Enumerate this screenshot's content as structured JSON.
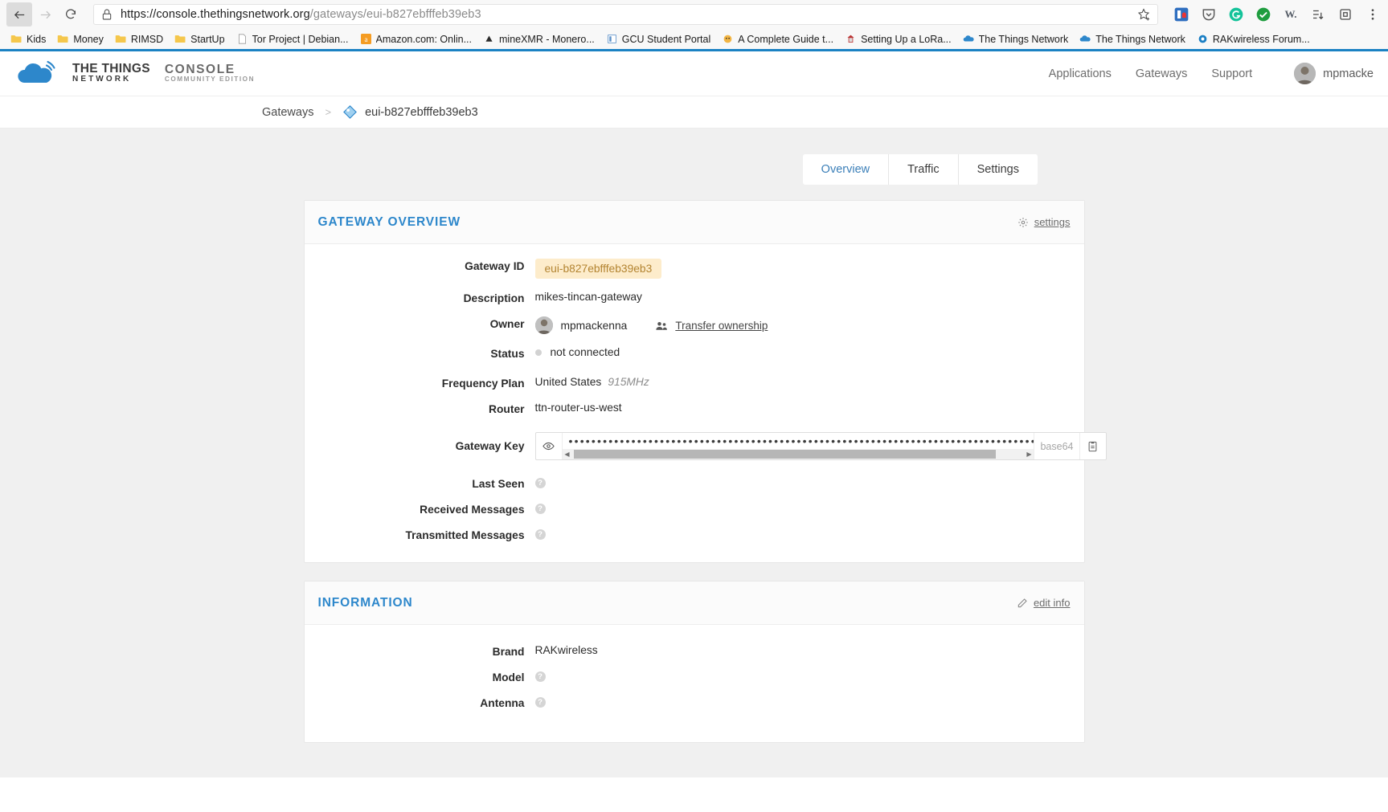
{
  "browser": {
    "back_icon": "arrow-left-icon",
    "forward_icon": "arrow-right-icon",
    "reload_icon": "reload-icon",
    "lock_icon": "lock-icon",
    "url_host": "https://console.thethingsnetwork.org",
    "url_path": "/gateways/eui-b827ebfffeb39eb3",
    "url_full": "https://console.thethingsnetwork.org/gateways/eui-b827ebfffeb39eb3",
    "star_icon": "favorite-star-icon",
    "extensions": [
      {
        "name": "lastpass-extension-icon",
        "color": "#2f6fc0"
      },
      {
        "name": "pocket-extension-icon",
        "color": "#5a5a5a"
      },
      {
        "name": "grammarly-extension-icon",
        "color": "#14c39a"
      },
      {
        "name": "checkmark-extension-icon",
        "color": "#1f9d3f"
      },
      {
        "name": "wikipedia-extension-icon",
        "color": "#555c66"
      },
      {
        "name": "collections-icon",
        "color": "#4a4a4a"
      },
      {
        "name": "browser-extensions-icon",
        "color": "#4a4a4a"
      },
      {
        "name": "browser-settings-icon",
        "color": "#4a4a4a"
      }
    ],
    "bookmarks": [
      {
        "label": "Kids",
        "icon": "folder-icon",
        "type": "folder"
      },
      {
        "label": "Money",
        "icon": "folder-icon",
        "type": "folder"
      },
      {
        "label": "RIMSD",
        "icon": "folder-icon",
        "type": "folder"
      },
      {
        "label": "StartUp",
        "icon": "folder-icon",
        "type": "folder"
      },
      {
        "label": "Tor Project | Debian...",
        "icon": "page-icon",
        "type": "link"
      },
      {
        "label": "Amazon.com: Onlin...",
        "icon": "amazon-favicon",
        "type": "link"
      },
      {
        "label": "mineXMR - Monero...",
        "icon": "minexmr-favicon",
        "type": "link"
      },
      {
        "label": "GCU Student Portal",
        "icon": "gcu-favicon",
        "type": "link"
      },
      {
        "label": "A Complete Guide t...",
        "icon": "fox-favicon",
        "type": "link"
      },
      {
        "label": "Setting Up a LoRa...",
        "icon": "cp-favicon",
        "type": "link"
      },
      {
        "label": "The Things Network",
        "icon": "ttn-cloud-favicon",
        "type": "link"
      },
      {
        "label": "The Things Network",
        "icon": "ttn-cloud-favicon",
        "type": "link"
      },
      {
        "label": "RAKwireless Forum...",
        "icon": "rak-favicon",
        "type": "link"
      }
    ]
  },
  "header": {
    "logo_icon": "ttn-cloud-logo",
    "brand_line1": "THE THINGS",
    "brand_line2": "NETWORK",
    "product_line1": "CONSOLE",
    "product_line2": "COMMUNITY EDITION",
    "nav": [
      {
        "label": "Applications",
        "name": "nav-applications"
      },
      {
        "label": "Gateways",
        "name": "nav-gateways"
      },
      {
        "label": "Support",
        "name": "nav-support"
      }
    ],
    "username": "mpmacke",
    "avatar_icon": "user-avatar"
  },
  "breadcrumb": {
    "root": "Gateways",
    "separator": ">",
    "gateway_icon": "gateway-tag-icon",
    "current": "eui-b827ebfffeb39eb3"
  },
  "tabs": [
    {
      "label": "Overview",
      "active": true
    },
    {
      "label": "Traffic",
      "active": false
    },
    {
      "label": "Settings",
      "active": false
    }
  ],
  "gateway_overview": {
    "title": "GATEWAY OVERVIEW",
    "action_label": "settings",
    "action_icon": "gear-icon",
    "fields": {
      "gateway_id_label": "Gateway ID",
      "gateway_id_value": "eui-b827ebfffeb39eb3",
      "description_label": "Description",
      "description_value": "mikes-tincan-gateway",
      "owner_label": "Owner",
      "owner_value": "mpmackenna",
      "transfer_label": "Transfer ownership",
      "transfer_icon": "people-icon",
      "status_label": "Status",
      "status_value": "not connected",
      "frequency_plan_label": "Frequency Plan",
      "frequency_plan_value": "United States",
      "frequency_plan_freq": "915MHz",
      "router_label": "Router",
      "router_value": "ttn-router-us-west",
      "gateway_key_label": "Gateway Key",
      "gateway_key_value": "••••••••••••••••••••••••••••••••••••••••••••••••••••••••••••••••••••••••••••••••••••••••••••••••••••••••••••••••••••••••••••••••",
      "gateway_key_format": "base64",
      "eye_icon": "eye-icon",
      "copy_icon": "clipboard-copy-icon",
      "last_seen_label": "Last Seen",
      "last_seen_value": "?",
      "received_messages_label": "Received Messages",
      "received_messages_value": "?",
      "transmitted_messages_label": "Transmitted Messages",
      "transmitted_messages_value": "?"
    }
  },
  "information": {
    "title": "INFORMATION",
    "action_label": "edit info",
    "action_icon": "pencil-icon",
    "fields": {
      "brand_label": "Brand",
      "brand_value": "RAKwireless",
      "model_label": "Model",
      "model_value": "?",
      "antenna_label": "Antenna",
      "antenna_value": "?"
    }
  },
  "colors": {
    "accent_blue": "#2d87cb",
    "pill_bg": "#fdeccb",
    "pill_text": "#b38431",
    "page_bg": "#f0f0f0",
    "bookmark_underline": "#1b82c3"
  }
}
